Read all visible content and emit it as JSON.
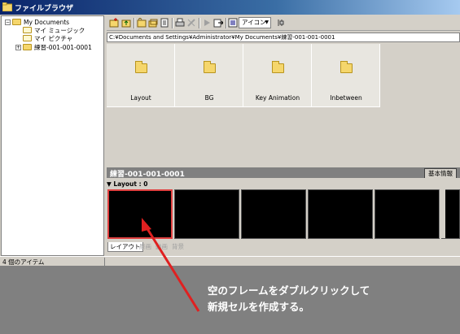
{
  "window": {
    "title": "ファイルブラウザ"
  },
  "tree": {
    "items": [
      {
        "label": "My Documents",
        "icon": "folder-icon",
        "expander": "⊟"
      },
      {
        "label": "マイ ミュージック",
        "icon": "folder-doc-icon"
      },
      {
        "label": "マイ ピクチャ",
        "icon": "folder-doc-icon"
      },
      {
        "label": "練習-001-001-0001",
        "icon": "folder-icon",
        "expander": "⊞"
      }
    ]
  },
  "toolbar": {
    "view_select": "アイコン"
  },
  "address": "C:¥Documents and Settings¥Administrator¥My Documents¥練習-001-001-0001",
  "files": [
    "Layout",
    "BG",
    "Key Animation",
    "Inbetween"
  ],
  "sequence": {
    "title": "練習-001-001-0001",
    "tab": "基本情報"
  },
  "layer": {
    "header": "Layout : 0"
  },
  "layer_tabs": [
    "レイアウト",
    "原画",
    "動画",
    "背景"
  ],
  "status": {
    "text": "4 個のアイテム"
  },
  "annotation": {
    "lines": [
      "空のフレームをダブルクリックして",
      "新規セルを作成する。"
    ],
    "color": "#e02020"
  }
}
